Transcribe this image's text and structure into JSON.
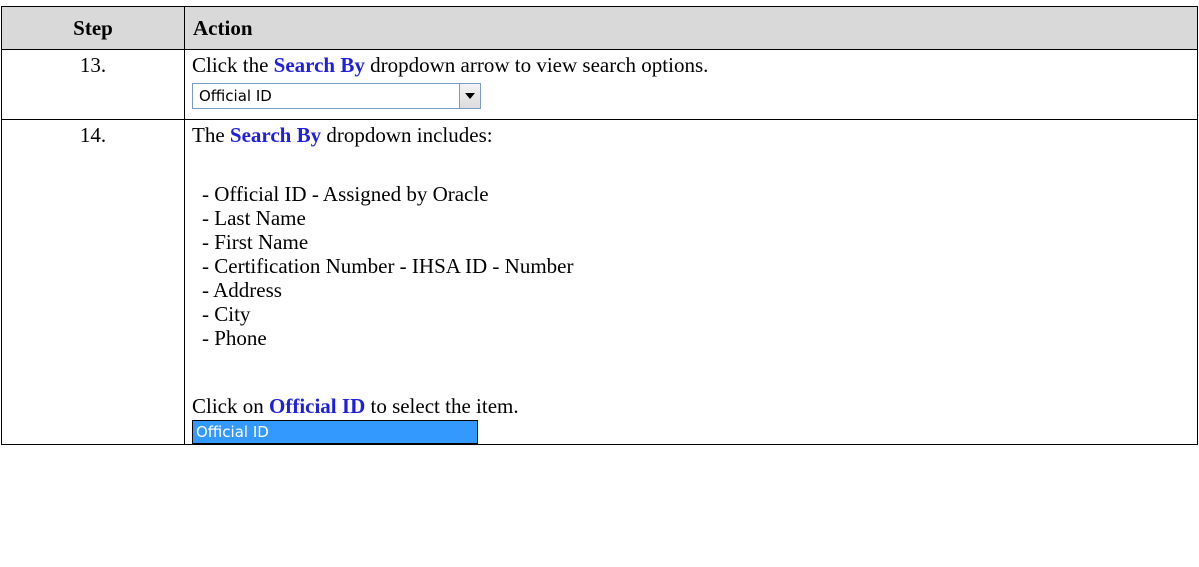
{
  "table": {
    "header_step": "Step",
    "header_action": "Action"
  },
  "rows": [
    {
      "step": "13.",
      "text_before": "Click the ",
      "highlight": "Search By",
      "text_after": " dropdown arrow to view search options.",
      "dropdown_value": "Official ID"
    },
    {
      "step": "14.",
      "intro_before": "The ",
      "intro_highlight": "Search By",
      "intro_after": " dropdown includes:",
      "options": [
        "- Official ID - Assigned by Oracle",
        "- Last Name",
        "- First Name",
        "- Certification Number - IHSA ID - Number",
        "- Address",
        "- City",
        "- Phone"
      ],
      "select_before": "Click on ",
      "select_highlight": "Official ID",
      "select_after": " to select the item.",
      "selected_item": "Official ID"
    }
  ],
  "colors": {
    "highlight": "#1f1fe0",
    "header_bg": "#d9d9d9",
    "selection_bg": "#3399ff"
  },
  "icons": {
    "dropdown": "chevron-down-icon"
  }
}
